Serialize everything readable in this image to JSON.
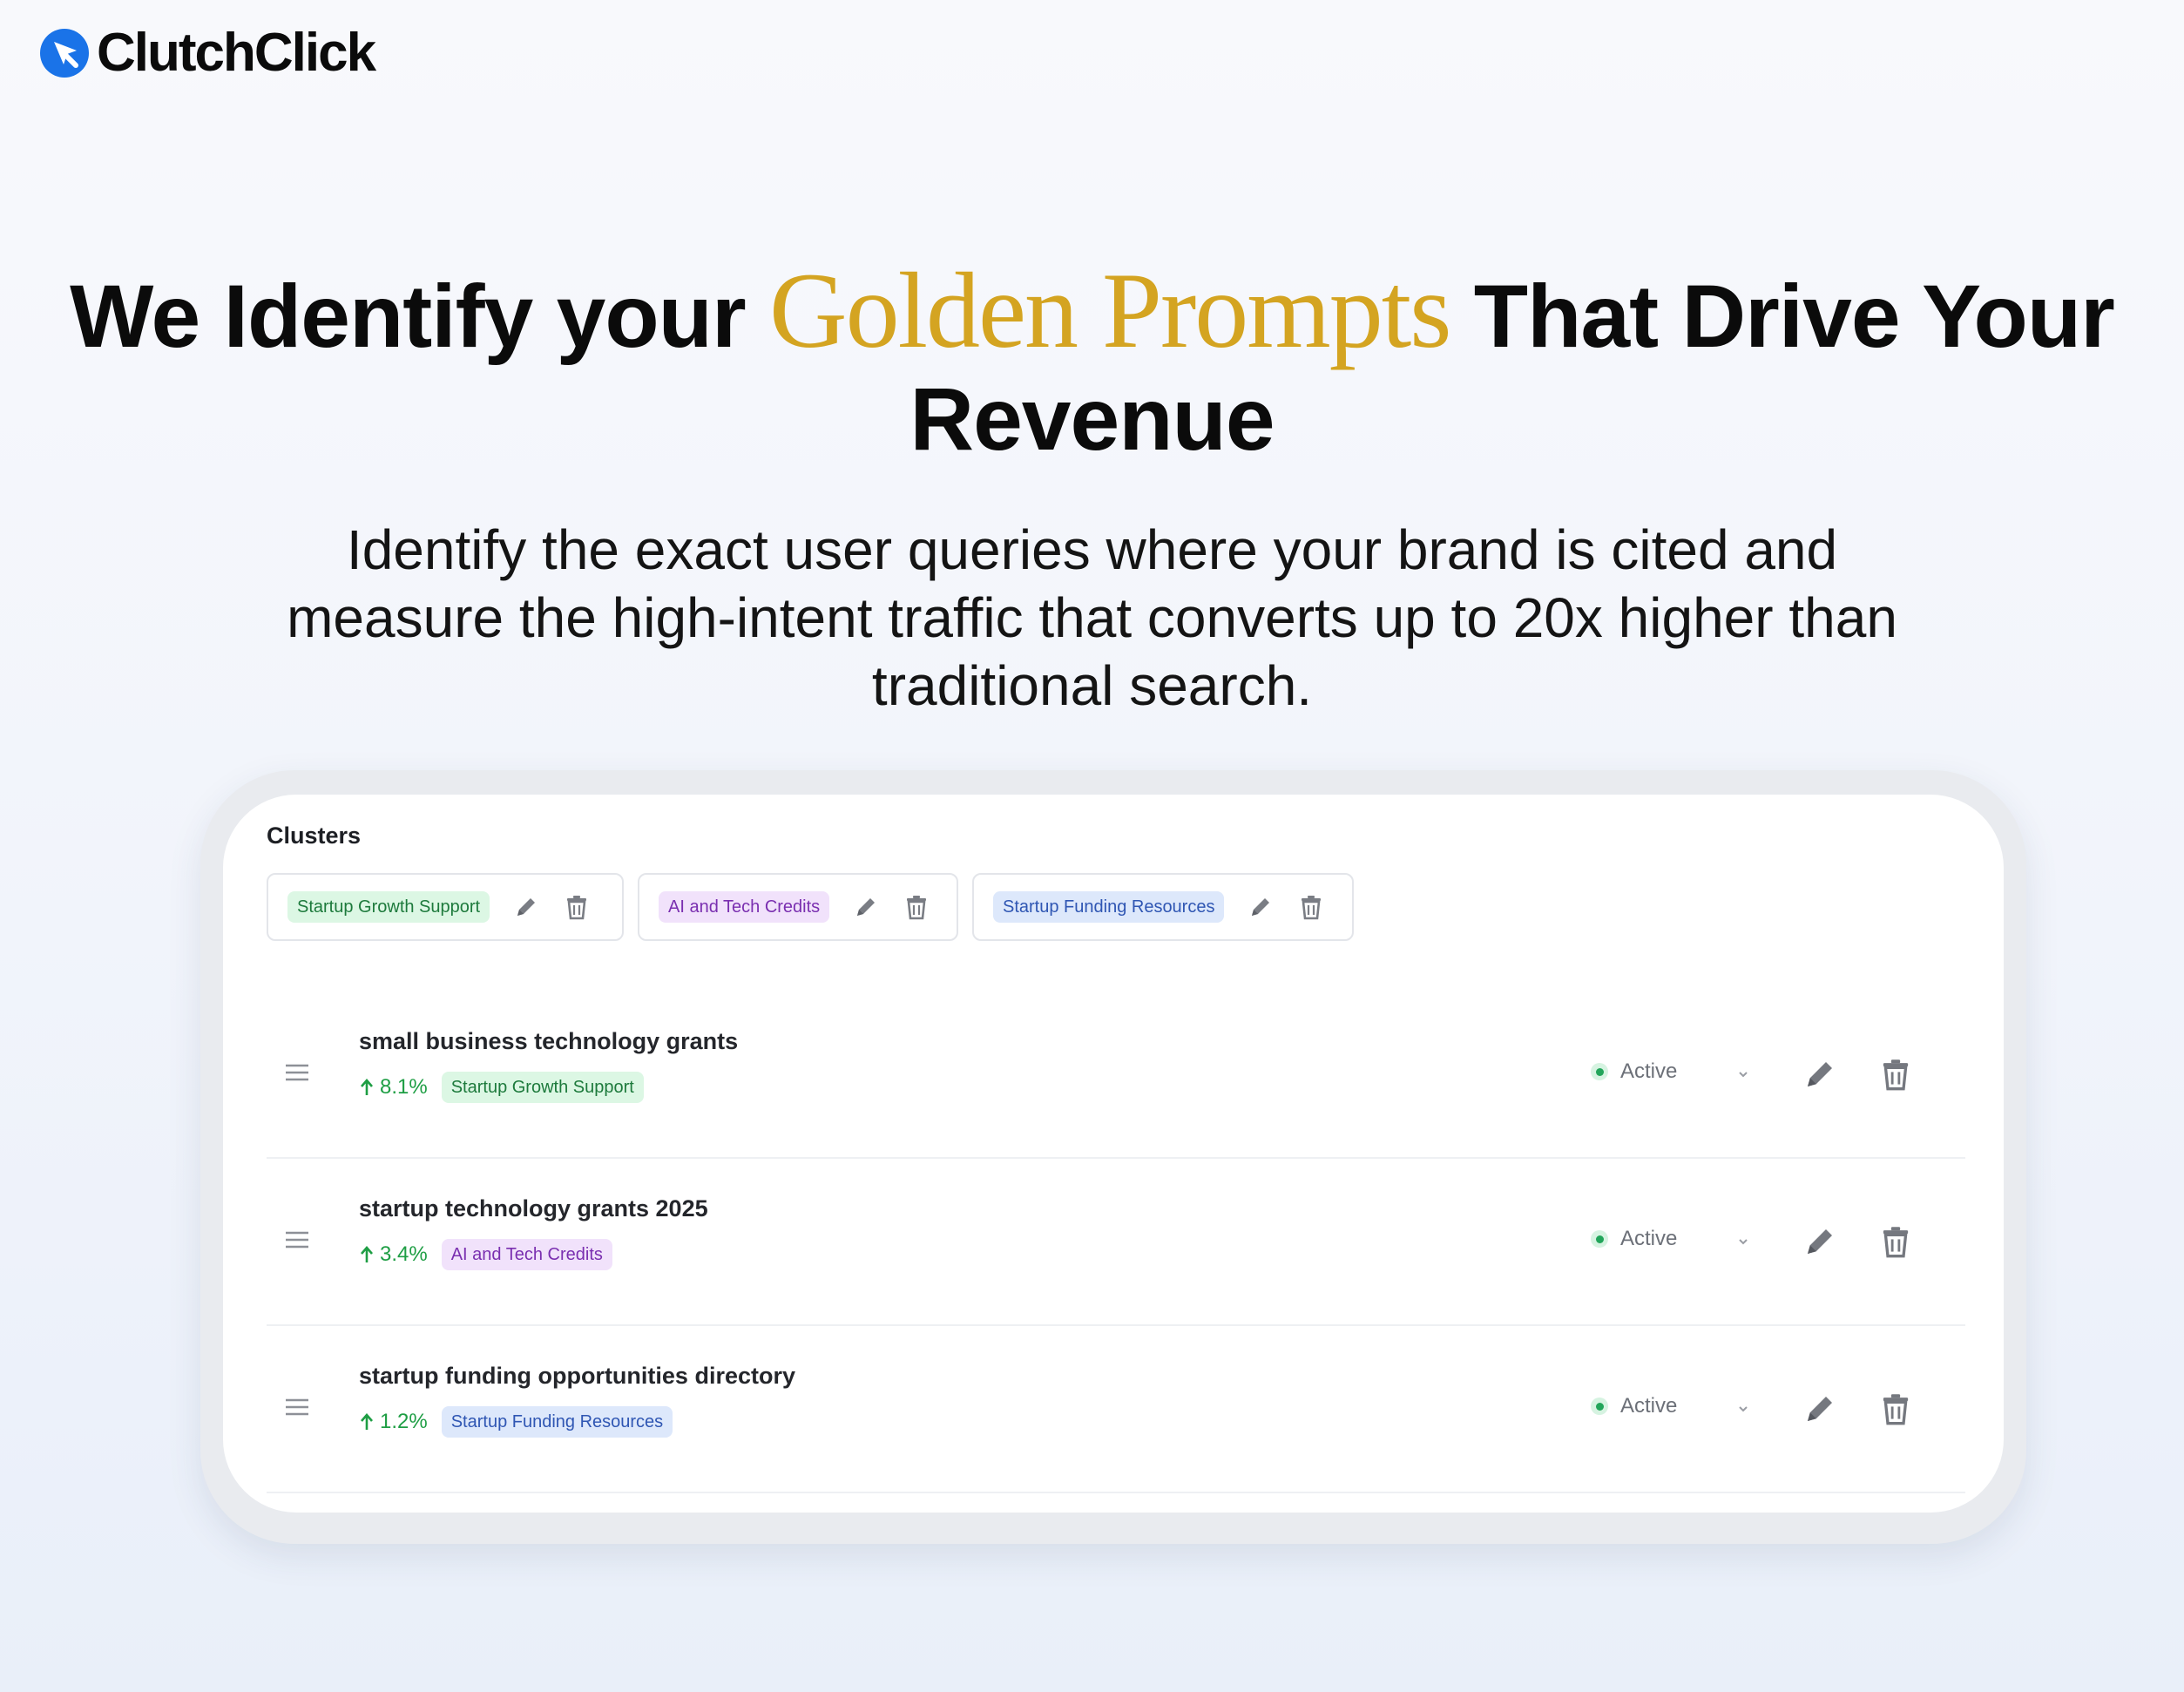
{
  "brand": {
    "name": "ClutchClick",
    "accent": "#1a73e8"
  },
  "hero": {
    "title_before": "We Identify your ",
    "title_highlight": "Golden Prompts",
    "title_after": " That Drive Your Revenue",
    "highlight_color": "#d4a421",
    "subtitle": "Identify the exact user queries where your brand is cited and measure the high-intent traffic that converts up to 20x higher than traditional search."
  },
  "panel": {
    "clusters_title": "Clusters",
    "clusters": [
      {
        "label": "Startup Growth Support",
        "color": "green",
        "edit_icon": "pencil-icon",
        "delete_icon": "trash-icon"
      },
      {
        "label": "AI and Tech Credits",
        "color": "purple",
        "edit_icon": "pencil-icon",
        "delete_icon": "trash-icon"
      },
      {
        "label": "Startup Funding Resources",
        "color": "blue",
        "edit_icon": "pencil-icon",
        "delete_icon": "trash-icon"
      }
    ],
    "prompts": [
      {
        "title": "small business technology grants",
        "trend": "8.1%",
        "trend_icon": "arrow-up-icon",
        "cluster": "Startup Growth Support",
        "cluster_color": "green",
        "status": "Active"
      },
      {
        "title": "startup technology grants 2025",
        "trend": "3.4%",
        "trend_icon": "arrow-up-icon",
        "cluster": "AI and Tech Credits",
        "cluster_color": "purple",
        "status": "Active"
      },
      {
        "title": "startup funding opportunities directory",
        "trend": "1.2%",
        "trend_icon": "arrow-up-icon",
        "cluster": "Startup Funding Resources",
        "cluster_color": "blue",
        "status": "Active"
      }
    ]
  }
}
